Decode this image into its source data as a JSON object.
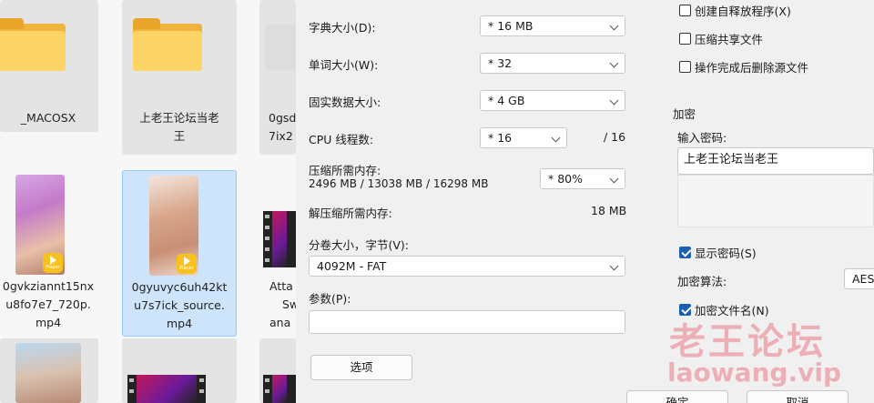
{
  "explorer": {
    "items": [
      {
        "name_lines": [
          "_MACOSX"
        ]
      },
      {
        "name_lines": [
          "上老王论坛当老",
          "王"
        ]
      },
      {
        "name_lines": [
          "0gsd",
          "7ix2"
        ]
      },
      {
        "name_lines": [
          "0gvkziannt15nx",
          "u8fo7e7_720p.",
          "mp4"
        ]
      },
      {
        "name_lines": [
          "0gyuvyc6uh42kt",
          "u7s7ick_source.",
          "mp4"
        ]
      },
      {
        "name_lines": [
          "Atta",
          "Sw",
          "ana"
        ]
      }
    ],
    "badge_text": "Player"
  },
  "dialog": {
    "dict_size": {
      "label": "字典大小(D):",
      "value": "* 16 MB"
    },
    "word_size": {
      "label": "单词大小(W):",
      "value": "* 32"
    },
    "solid_size": {
      "label": "固实数据大小:",
      "value": "* 4 GB"
    },
    "cpu_threads": {
      "label": "CPU 线程数:",
      "value": "* 16",
      "max": "/ 16"
    },
    "mem_compress": {
      "label": "压缩所需内存:",
      "detail": "2496 MB / 13038 MB / 16298 MB",
      "value": "* 80%"
    },
    "mem_decompress": {
      "label": "解压缩所需内存:",
      "value": "18 MB"
    },
    "volume": {
      "label": "分卷大小，字节(V):",
      "value": "4092M - FAT"
    },
    "params": {
      "label": "参数(P):",
      "value": ""
    },
    "options_button": "选项",
    "checkboxes": [
      {
        "label": "创建自释放程序(X)",
        "checked": false
      },
      {
        "label": "压缩共享文件",
        "checked": false
      },
      {
        "label": "操作完成后删除源文件",
        "checked": false
      }
    ],
    "encryption": {
      "title": "加密",
      "password_label": "输入密码:",
      "password_value": "上老王论坛当老王",
      "show_password": {
        "label": "显示密码(S)",
        "checked": true
      },
      "method_label": "加密算法:",
      "method_value": "AES-",
      "encrypt_names": {
        "label": "加密文件名(N)",
        "checked": true
      }
    },
    "ok_button": "确定",
    "cancel_button": "取消"
  },
  "watermark": {
    "cn": "老王论坛",
    "url": "laowang.vip"
  }
}
